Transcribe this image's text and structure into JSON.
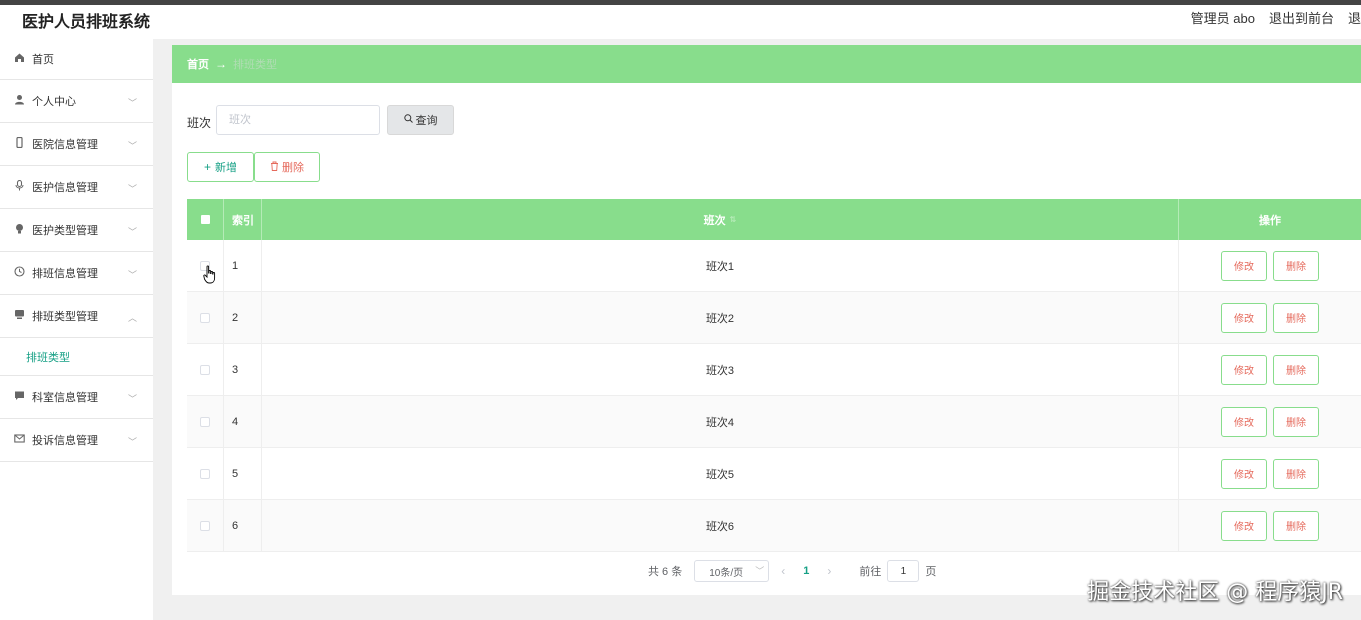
{
  "app": {
    "title": "医护人员排班系统",
    "user_label": "管理员 abo",
    "exit_front": "退出到前台",
    "exit_partial": "退"
  },
  "sidebar": {
    "items": [
      {
        "label": "首页",
        "icon": "home-icon"
      },
      {
        "label": "个人中心",
        "icon": "user-icon"
      },
      {
        "label": "医院信息管理",
        "icon": "phone-icon"
      },
      {
        "label": "医护信息管理",
        "icon": "microphone-icon"
      },
      {
        "label": "医护类型管理",
        "icon": "bulb-icon"
      },
      {
        "label": "排班信息管理",
        "icon": "clock-icon"
      },
      {
        "label": "排班类型管理",
        "icon": "monitor-icon"
      },
      {
        "label": "科室信息管理",
        "icon": "chat-icon"
      },
      {
        "label": "投诉信息管理",
        "icon": "mail-icon"
      }
    ],
    "active_sub": "排班类型"
  },
  "breadcrumb": {
    "home": "首页",
    "arrow": "→",
    "current": "排班类型"
  },
  "search": {
    "label": "班次",
    "placeholder": "班次",
    "button": "查询"
  },
  "actions": {
    "add": "新增",
    "delete": "删除"
  },
  "table": {
    "headers": {
      "index": "索引",
      "name": "班次",
      "ops": "操作"
    },
    "rows": [
      {
        "index": "1",
        "name": "班次1"
      },
      {
        "index": "2",
        "name": "班次2"
      },
      {
        "index": "3",
        "name": "班次3"
      },
      {
        "index": "4",
        "name": "班次4"
      },
      {
        "index": "5",
        "name": "班次5"
      },
      {
        "index": "6",
        "name": "班次6"
      }
    ],
    "edit_label": "修改",
    "delete_label": "删除"
  },
  "pagination": {
    "total": "共 6 条",
    "page_size": "10条/页",
    "current_page": "1",
    "goto_label": "前往",
    "goto_value": "1",
    "page_unit": "页"
  },
  "watermark": "掘金技术社区 @ 程序猿JR",
  "colors": {
    "accent_green": "#88dd8c",
    "teal": "#16a085",
    "danger": "#e5695b"
  }
}
